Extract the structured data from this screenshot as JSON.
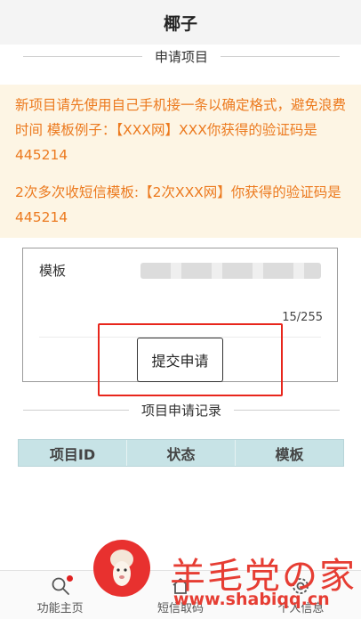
{
  "header": {
    "title": "椰子"
  },
  "section_apply": {
    "title": "申请项目"
  },
  "notice": {
    "line1": "新项目请先使用自己手机接一条以确定格式，避免浪费时间 模板例子：【XXX网】XXX你获得的验证码是445214",
    "line2": "2次多次收短信模板:【2次XXX网】你获得的验证码是445214"
  },
  "form": {
    "template_label": "模板",
    "template_value": "",
    "counter": "15/255",
    "submit_label": "提交申请"
  },
  "section_records": {
    "title": "项目申请记录",
    "columns": [
      "项目ID",
      "状态",
      "模板"
    ]
  },
  "tabbar": {
    "tabs": [
      {
        "label": "功能主页",
        "icon": "search-icon",
        "has_badge": true
      },
      {
        "label": "短信取码",
        "icon": "home-icon",
        "has_badge": false
      },
      {
        "label": "个人信息",
        "icon": "gear-icon",
        "has_badge": false
      }
    ]
  },
  "watermark": {
    "name": "羊毛党の家",
    "url": "www.shabiqq.cn"
  },
  "colors": {
    "notice_text": "#ec7a1f",
    "notice_bg": "#fdf5e4",
    "table_head_bg": "#c7e3e6",
    "highlight": "#e8261c"
  }
}
